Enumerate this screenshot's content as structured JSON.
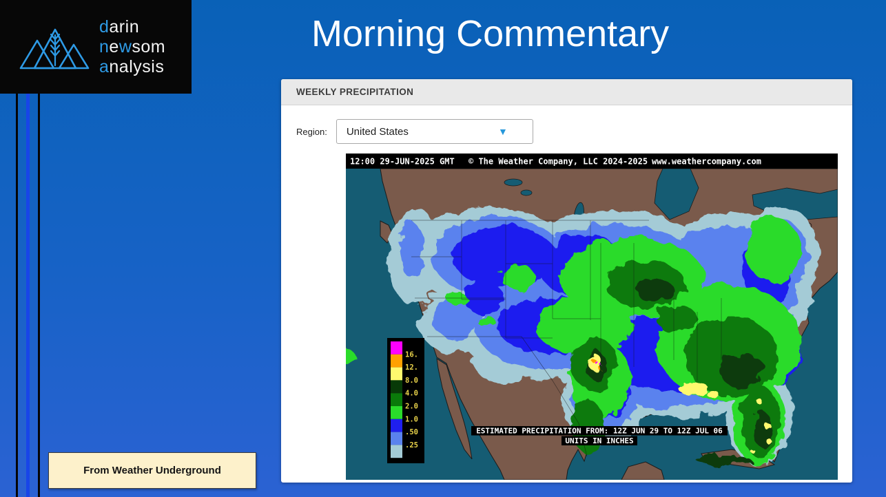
{
  "page_title": "Morning Commentary",
  "logo": {
    "l1a": "d",
    "l1b": "arin",
    "l2a": "n",
    "l2b": "e",
    "l2c": "w",
    "l2d": "som",
    "l3a": "a",
    "l3b": "nalysis",
    "accent_color": "#2E9BE6"
  },
  "card": {
    "header": "WEEKLY PRECIPITATION",
    "region_label": "Region:",
    "region_value": "United States",
    "caret_icon": "▼"
  },
  "map": {
    "header": {
      "time": "12:00 29-JUN-2025 GMT",
      "copyright": "© The Weather Company, LLC 2024-2025",
      "website": "www.weathercompany.com"
    },
    "footer": {
      "line1": "ESTIMATED PRECIPITATION FROM: 12Z JUN 29 TO 12Z JUL 06",
      "line2": "UNITS IN INCHES"
    },
    "legend": {
      "labels": [
        "16.",
        "12.",
        "8.0",
        "4.0",
        "2.0",
        "1.0",
        ".50",
        ".25"
      ],
      "colors": [
        "#FF00FF",
        "#FFA000",
        "#FFF96E",
        "#083A08",
        "#0A7A0A",
        "#2ADB2A",
        "#1F1FEF",
        "#5A82EE",
        "#A4CBD6"
      ],
      "units": "inches"
    },
    "colors": {
      "ocean": "#155C73",
      "land": "#7A5A4B"
    }
  },
  "source_note": "From Weather Underground"
}
